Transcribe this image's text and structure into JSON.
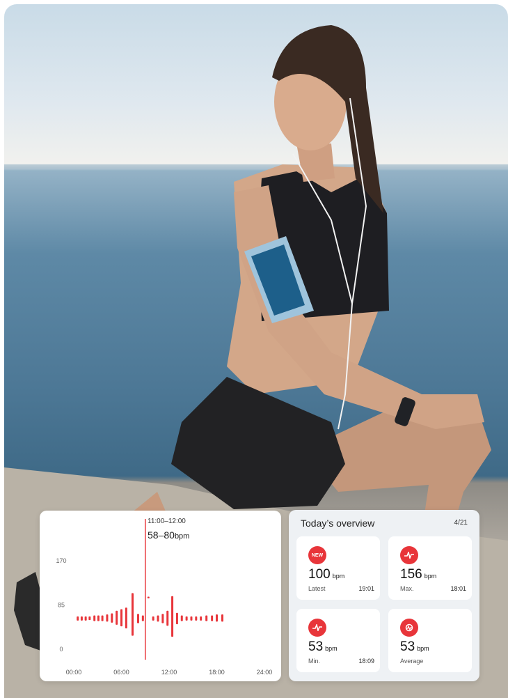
{
  "chart_data": {
    "type": "bar",
    "y_ticks": [
      "170",
      "85",
      "0"
    ],
    "ylim": [
      0,
      170
    ],
    "x_ticks": [
      "00:00",
      "06:00",
      "12:00",
      "18:00",
      "24:00"
    ],
    "xlim": [
      0,
      24
    ],
    "tooltip": {
      "time": "11:00–12:00",
      "range": "58–80",
      "unit": "bpm"
    },
    "bars": [
      {
        "x": 0.5,
        "low": 55,
        "high": 63
      },
      {
        "x": 1.0,
        "low": 55,
        "high": 63
      },
      {
        "x": 1.5,
        "low": 55,
        "high": 63
      },
      {
        "x": 2.0,
        "low": 56,
        "high": 63
      },
      {
        "x": 2.6,
        "low": 54,
        "high": 65
      },
      {
        "x": 3.1,
        "low": 54,
        "high": 65
      },
      {
        "x": 3.6,
        "low": 54,
        "high": 65
      },
      {
        "x": 4.2,
        "low": 53,
        "high": 67
      },
      {
        "x": 4.8,
        "low": 51,
        "high": 69
      },
      {
        "x": 5.4,
        "low": 47,
        "high": 74
      },
      {
        "x": 6.0,
        "low": 44,
        "high": 77
      },
      {
        "x": 6.6,
        "low": 40,
        "high": 80
      },
      {
        "x": 7.4,
        "low": 26,
        "high": 108
      },
      {
        "x": 8.1,
        "low": 50,
        "high": 68
      },
      {
        "x": 8.7,
        "low": 54,
        "high": 65
      },
      {
        "x": 9.4,
        "low": 98,
        "high": 101
      },
      {
        "x": 10.0,
        "low": 55,
        "high": 63
      },
      {
        "x": 10.6,
        "low": 53,
        "high": 65
      },
      {
        "x": 11.2,
        "low": 50,
        "high": 68
      },
      {
        "x": 11.8,
        "low": 45,
        "high": 74
      },
      {
        "x": 12.4,
        "low": 24,
        "high": 102
      },
      {
        "x": 13.0,
        "low": 48,
        "high": 70
      },
      {
        "x": 13.6,
        "low": 54,
        "high": 65
      },
      {
        "x": 14.2,
        "low": 55,
        "high": 63
      },
      {
        "x": 14.8,
        "low": 55,
        "high": 63
      },
      {
        "x": 15.4,
        "low": 55,
        "high": 63
      },
      {
        "x": 16.0,
        "low": 55,
        "high": 63
      },
      {
        "x": 16.7,
        "low": 54,
        "high": 65
      },
      {
        "x": 17.4,
        "low": 54,
        "high": 65
      },
      {
        "x": 18.0,
        "low": 53,
        "high": 67
      },
      {
        "x": 18.7,
        "low": 53,
        "high": 67
      }
    ],
    "selected_x": 9.0,
    "colors": {
      "bar": "#e8353a",
      "cursor": "#e8353a",
      "axis": "#e3e3e3"
    }
  },
  "overview": {
    "title": "Today’s overview",
    "date": "4/21",
    "tiles": [
      {
        "icon": "new-badge-icon",
        "icon_text": "NEW",
        "value": "100",
        "unit": "bpm",
        "label": "Latest",
        "time": "19:01"
      },
      {
        "icon": "heart-pulse-icon",
        "value": "156",
        "unit": "bpm",
        "label": "Max.",
        "time": "18:01"
      },
      {
        "icon": "heart-pulse-icon",
        "value": "53",
        "unit": "bpm",
        "label": "Min.",
        "time": "18:09"
      },
      {
        "icon": "average-icon",
        "value": "53",
        "unit": "bpm",
        "label": "Average",
        "time": ""
      }
    ],
    "accent": "#e8353a"
  }
}
